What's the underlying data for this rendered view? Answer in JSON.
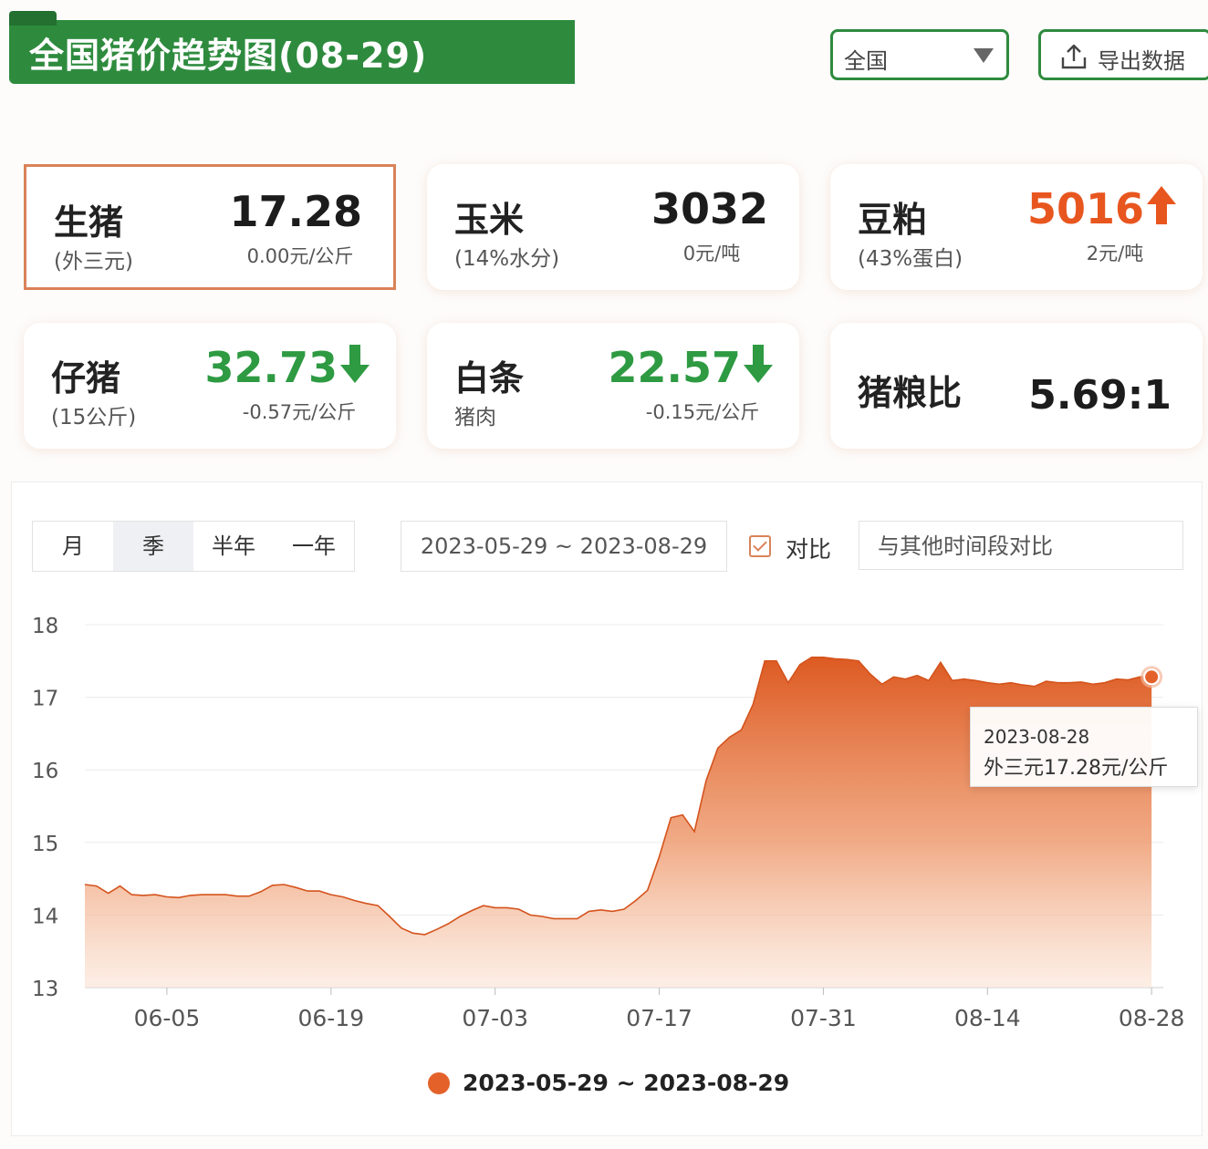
{
  "header": {
    "title": "全国猪价趋势图(08-29)",
    "region": "全国",
    "export_label": "导出数据"
  },
  "cards": [
    {
      "name": "生猪",
      "sub": "(外三元)",
      "value": "17.28",
      "change": "0.00元/公斤",
      "trend": "flat"
    },
    {
      "name": "玉米",
      "sub": "(14%水分)",
      "value": "3032",
      "change": "0元/吨",
      "trend": "flat"
    },
    {
      "name": "豆粕",
      "sub": "(43%蛋白)",
      "value": "5016",
      "change": "2元/吨",
      "trend": "up"
    },
    {
      "name": "仔猪",
      "sub": "(15公斤)",
      "value": "32.73",
      "change": "-0.57元/公斤",
      "trend": "down"
    },
    {
      "name": "白条",
      "sub": "猪肉",
      "value": "22.57",
      "change": "-0.15元/公斤",
      "trend": "down"
    },
    {
      "name": "猪粮比",
      "sub": "",
      "value": "5.69:1",
      "change": "",
      "trend": "flat"
    }
  ],
  "controls": {
    "periods": [
      "月",
      "季",
      "半年",
      "一年"
    ],
    "selected_period": "季",
    "date_range": "2023-05-29 ~ 2023-08-29",
    "compare_label": "对比",
    "compare_checked": true,
    "compare_placeholder": "与其他时间段对比"
  },
  "tooltip": {
    "date": "2023-08-28",
    "value_text": "外三元17.28元/公斤"
  },
  "colors": {
    "brand_green": "#2e8b3e",
    "series": "#e4622a",
    "up": "#e8561f",
    "down": "#2e9a42"
  },
  "chart_data": {
    "type": "area",
    "ylim": [
      13,
      18
    ],
    "yticks": [
      13,
      14,
      15,
      16,
      17,
      18
    ],
    "xlim": [
      "2023-05-29",
      "2023-08-29"
    ],
    "xticks": [
      "06-05",
      "06-19",
      "07-03",
      "07-17",
      "07-31",
      "08-14",
      "08-28"
    ],
    "legend": "2023-05-29 ~ 2023-08-29",
    "series": [
      {
        "name": "2023-05-29 ~ 2023-08-29",
        "x": [
          "2023-05-29",
          "2023-05-30",
          "2023-05-31",
          "2023-06-01",
          "2023-06-02",
          "2023-06-03",
          "2023-06-04",
          "2023-06-05",
          "2023-06-06",
          "2023-06-07",
          "2023-06-08",
          "2023-06-09",
          "2023-06-10",
          "2023-06-11",
          "2023-06-12",
          "2023-06-13",
          "2023-06-14",
          "2023-06-15",
          "2023-06-16",
          "2023-06-17",
          "2023-06-18",
          "2023-06-19",
          "2023-06-20",
          "2023-06-21",
          "2023-06-22",
          "2023-06-23",
          "2023-06-24",
          "2023-06-25",
          "2023-06-26",
          "2023-06-27",
          "2023-06-28",
          "2023-06-29",
          "2023-06-30",
          "2023-07-01",
          "2023-07-02",
          "2023-07-03",
          "2023-07-04",
          "2023-07-05",
          "2023-07-06",
          "2023-07-07",
          "2023-07-08",
          "2023-07-09",
          "2023-07-10",
          "2023-07-11",
          "2023-07-12",
          "2023-07-13",
          "2023-07-14",
          "2023-07-15",
          "2023-07-16",
          "2023-07-17",
          "2023-07-18",
          "2023-07-19",
          "2023-07-20",
          "2023-07-21",
          "2023-07-22",
          "2023-07-23",
          "2023-07-24",
          "2023-07-25",
          "2023-07-26",
          "2023-07-27",
          "2023-07-28",
          "2023-07-29",
          "2023-07-30",
          "2023-07-31",
          "2023-08-01",
          "2023-08-02",
          "2023-08-03",
          "2023-08-04",
          "2023-08-05",
          "2023-08-06",
          "2023-08-07",
          "2023-08-08",
          "2023-08-09",
          "2023-08-10",
          "2023-08-11",
          "2023-08-12",
          "2023-08-13",
          "2023-08-14",
          "2023-08-15",
          "2023-08-16",
          "2023-08-17",
          "2023-08-18",
          "2023-08-19",
          "2023-08-20",
          "2023-08-21",
          "2023-08-22",
          "2023-08-23",
          "2023-08-24",
          "2023-08-25",
          "2023-08-26",
          "2023-08-27",
          "2023-08-28"
        ],
        "values": [
          14.42,
          14.4,
          14.3,
          14.4,
          14.28,
          14.27,
          14.28,
          14.25,
          14.24,
          14.27,
          14.28,
          14.28,
          14.28,
          14.26,
          14.26,
          14.32,
          14.41,
          14.42,
          14.38,
          14.33,
          14.33,
          14.28,
          14.25,
          14.2,
          14.16,
          14.13,
          13.98,
          13.82,
          13.75,
          13.73,
          13.8,
          13.88,
          13.98,
          14.06,
          14.13,
          14.1,
          14.1,
          14.08,
          14.0,
          13.98,
          13.95,
          13.95,
          13.95,
          14.05,
          14.07,
          14.05,
          14.08,
          14.2,
          14.34,
          14.8,
          15.34,
          15.38,
          15.15,
          15.85,
          16.3,
          16.45,
          16.55,
          16.9,
          17.5,
          17.5,
          17.2,
          17.45,
          17.55,
          17.55,
          17.53,
          17.52,
          17.5,
          17.32,
          17.18,
          17.28,
          17.25,
          17.3,
          17.23,
          17.48,
          17.23,
          17.25,
          17.23,
          17.2,
          17.18,
          17.2,
          17.17,
          17.15,
          17.22,
          17.2,
          17.2,
          17.21,
          17.18,
          17.2,
          17.25,
          17.24,
          17.28,
          17.28
        ]
      }
    ]
  }
}
